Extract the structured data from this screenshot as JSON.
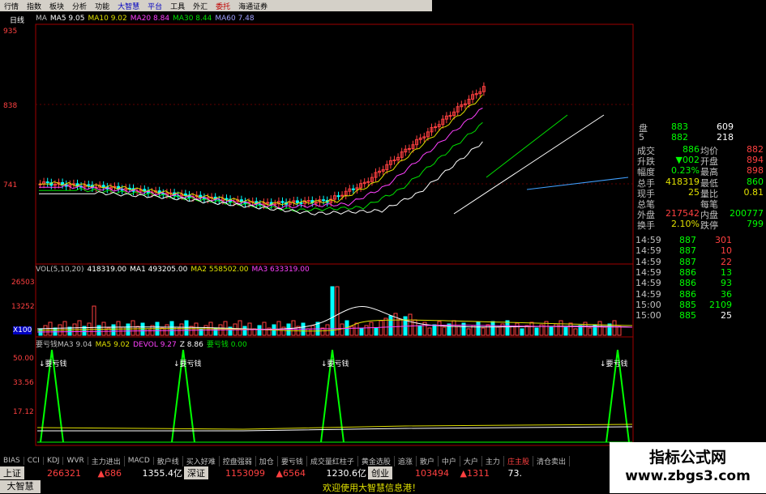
{
  "menu": [
    "行情",
    "指数",
    "板块",
    "分析",
    "功能",
    "大智慧",
    "平台",
    "工具",
    "外汇",
    "委托",
    "海通证券"
  ],
  "chart": {
    "period_label": "日线",
    "ma_legend": [
      {
        "text": "MA",
        "color": "#c0c0c0"
      },
      {
        "text": "MA5 9.05",
        "color": "#ffffff"
      },
      {
        "text": "MA10 9.02",
        "color": "#e0e000"
      },
      {
        "text": "MA20 8.84",
        "color": "#ff40ff"
      },
      {
        "text": "MA30 8.44",
        "color": "#00e000"
      },
      {
        "text": "MA60 7.48",
        "color": "#a0a0ff"
      }
    ],
    "price_ticks": [
      "935",
      "838",
      "741"
    ],
    "volume_legend": [
      {
        "text": "VOL(5,10,20)",
        "color": "#c0c0c0"
      },
      {
        "text": "418319.00",
        "color": "#ffffff"
      },
      {
        "text": "MA1 493205.00",
        "color": "#ffffff"
      },
      {
        "text": "MA2 558502.00",
        "color": "#e0e000"
      },
      {
        "text": "MA3 633319.00",
        "color": "#ff40ff"
      }
    ],
    "volume_ticks": [
      "26503",
      "13252",
      "X100"
    ],
    "indicator_legend": [
      {
        "text": "要亏钱MA3 9.04",
        "color": "#c0c0c0"
      },
      {
        "text": "MA5 9.02",
        "color": "#e0e000"
      },
      {
        "text": "DEVOL 9.27",
        "color": "#ff40ff"
      },
      {
        "text": "Z 8.86",
        "color": "#ffffff"
      },
      {
        "text": "要亏钱 0.00",
        "color": "#00e000"
      }
    ],
    "indicator_ticks": [
      "50.00",
      "33.56",
      "17.12"
    ],
    "signal_label": "↓要亏钱"
  },
  "quote": {
    "order_rows": [
      {
        "label": "盘",
        "p": "883",
        "v": "609"
      },
      {
        "label": "5",
        "p": "882",
        "v": "218"
      }
    ],
    "stats": [
      {
        "l1": "成交",
        "v1": "886",
        "l2": "均价",
        "v2": "882",
        "c1": "#00ff00",
        "c2": "#ff4040"
      },
      {
        "l1": "升跌",
        "v1": "▼002",
        "l2": "开盘",
        "v2": "894",
        "c1": "#00ff00",
        "c2": "#ff4040"
      },
      {
        "l1": "幅度",
        "v1": "0.23%",
        "l2": "最高",
        "v2": "898",
        "c1": "#00ff00",
        "c2": "#ff4040"
      },
      {
        "l1": "总手",
        "v1": "418319",
        "l2": "最低",
        "v2": "860",
        "c1": "#e0e000",
        "c2": "#00ff00"
      },
      {
        "l1": "现手",
        "v1": "25",
        "l2": "量比",
        "v2": "0.81",
        "c1": "#e0e000",
        "c2": "#e0e000"
      },
      {
        "l1": "总笔",
        "v1": "",
        "l2": "每笔",
        "v2": "",
        "c1": "#e0e000",
        "c2": "#e0e000"
      },
      {
        "l1": "外盘",
        "v1": "217542",
        "l2": "内盘",
        "v2": "200777",
        "c1": "#ff4040",
        "c2": "#00ff00"
      },
      {
        "l1": "换手",
        "v1": "2.10%",
        "l2": "跌停",
        "v2": "799",
        "c1": "#e0e000",
        "c2": "#00ff00"
      }
    ],
    "ticks": [
      {
        "t": "14:59",
        "p": "887",
        "v": "301",
        "vc": "#ff4040"
      },
      {
        "t": "14:59",
        "p": "887",
        "v": "10",
        "vc": "#ff4040"
      },
      {
        "t": "14:59",
        "p": "887",
        "v": "22",
        "vc": "#ff4040"
      },
      {
        "t": "14:59",
        "p": "886",
        "v": "13",
        "vc": "#00ff00"
      },
      {
        "t": "14:59",
        "p": "886",
        "v": "93",
        "vc": "#00ff00"
      },
      {
        "t": "14:59",
        "p": "886",
        "v": "36",
        "vc": "#00ff00"
      },
      {
        "t": "15:00",
        "p": "885",
        "v": "2109",
        "vc": "#00ff00"
      },
      {
        "t": "15:00",
        "p": "885",
        "v": "25",
        "vc": "#ffffff"
      }
    ]
  },
  "tabs": [
    "BIAS",
    "CCI",
    "KDJ",
    "WVR",
    "主力进出",
    "MACD",
    "散户线",
    "买入好难",
    "控盘强弱",
    "加仓",
    "要亏钱",
    "成交量红柱子",
    "黄金选股",
    "追涨",
    "散户",
    "中户",
    "大户",
    "主力",
    "庄主股",
    "清仓卖出"
  ],
  "active_tab": "庄主股",
  "status": {
    "sh_label": "上证",
    "sh_vol": "266321",
    "sh_chg": "▲686",
    "sh_idx": "1355.4亿",
    "sz_label": "深证",
    "sz_vol": "1153099",
    "sz_chg": "▲6564",
    "sz_idx": "1230.6亿",
    "cy_label": "创业",
    "cy_vol": "103494",
    "cy_chg": "▲1311",
    "cy_idx": "73.",
    "brand": "大智慧",
    "welcome": "欢迎使用大智慧信息港！"
  },
  "watermark": {
    "title": "指标公式网",
    "url": "www.zbgs3.com"
  }
}
